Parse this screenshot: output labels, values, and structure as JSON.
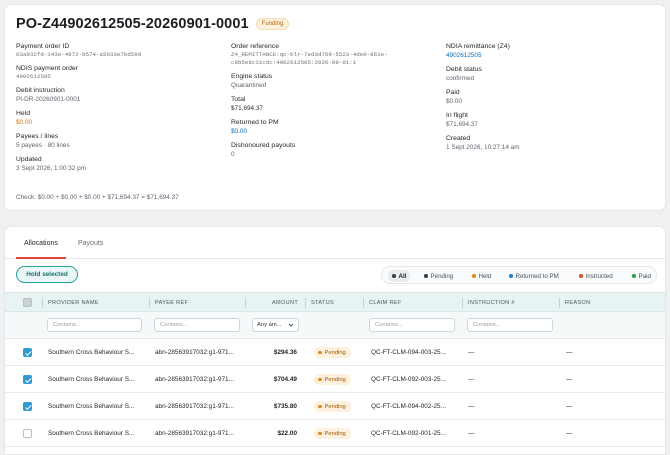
{
  "header": {
    "title": "PO-Z44902612505-20260901-0001",
    "badge": "Funding"
  },
  "details": {
    "col1": [
      {
        "label": "Payment order ID",
        "value": "03a932fd-143e-4972-b574-a5033e7bd59d",
        "style": "mono"
      },
      {
        "label": "NDIS payment order",
        "value": "4902612505",
        "style": "mono"
      },
      {
        "label": "Debit instruction",
        "value": "PI-DR-20260901-0001",
        "style": "plain"
      },
      {
        "label": "Held",
        "value": "$0.00",
        "style": "orange"
      },
      {
        "label": "Payees / lines",
        "value": "5 payees · 80 lines",
        "style": "plain"
      },
      {
        "label": "Updated",
        "value": "3 Sept 2026, 1:00:32 pm",
        "style": "plain"
      }
    ],
    "col2": [
      {
        "label": "Order reference",
        "value": "Z4_REMITTANCE:qc-blr-7ed3d769-5523-4de0-861e-c8b5e8c31cdc:4902612505:2026-09-01:1",
        "style": "mono"
      },
      {
        "label": "Engine status",
        "value": "Quarantined",
        "style": "plain"
      },
      {
        "label": "Total",
        "value": "$71,694.37",
        "style": "dark"
      },
      {
        "label": "Returned to PM",
        "value": "$0.00",
        "style": "blue"
      },
      {
        "label": "Dishonoured payouts",
        "value": "0",
        "style": "plain"
      }
    ],
    "col3": [
      {
        "label": "NDIA remittance (Z4)",
        "value": "4902612505",
        "style": "blue"
      },
      {
        "label": "Debit status",
        "value": "confirmed",
        "style": "plain"
      },
      {
        "label": "Paid",
        "value": "$0.00",
        "style": "plain"
      },
      {
        "label": "In flight",
        "value": "$71,694.37",
        "style": "plain"
      },
      {
        "label": "Created",
        "value": "1 Sept 2026, 10:27:14 am",
        "style": "plain"
      }
    ],
    "check": "Check: $0.00 + $0.00 + $0.00 + $71,694.37 = $71,694.37"
  },
  "tabs": [
    {
      "label": "Allocations",
      "active": true
    },
    {
      "label": "Payouts",
      "active": false
    }
  ],
  "toolbar": {
    "hold_label": "Hold selected"
  },
  "filters": [
    {
      "label": "All",
      "color": "#3b4148",
      "active": true
    },
    {
      "label": "Pending",
      "color": "#3b4148",
      "active": false
    },
    {
      "label": "Held",
      "color": "#e08a1e",
      "active": false
    },
    {
      "label": "Returned to PM",
      "color": "#1f86c9",
      "active": false
    },
    {
      "label": "Instructed",
      "color": "#d2562a",
      "active": false
    },
    {
      "label": "Paid",
      "color": "#2f9b4f",
      "active": false
    }
  ],
  "table": {
    "columns": [
      "PROVIDER NAME",
      "PAYEE REF",
      "AMOUNT",
      "STATUS",
      "CLAIM REF",
      "INSTRUCTION #",
      "REASON"
    ],
    "filter_placeholder": "Contains...",
    "amount_filter": "Any am...",
    "rows": [
      {
        "checked": true,
        "provider": "Southern Cross Behaviour S...",
        "payee": "abn-28563917032:g1-971...",
        "amount": "$294.36",
        "status": "Pending",
        "claim": "QC-FT-CLM-094-003-25...",
        "instruction": "—",
        "reason": "—"
      },
      {
        "checked": true,
        "provider": "Southern Cross Behaviour S...",
        "payee": "abn-28563917032:g1-971...",
        "amount": "$704.49",
        "status": "Pending",
        "claim": "QC-FT-CLM-092-003-25...",
        "instruction": "—",
        "reason": "—"
      },
      {
        "checked": true,
        "provider": "Southern Cross Behaviour S...",
        "payee": "abn-28563917032:g1-971...",
        "amount": "$735.80",
        "status": "Pending",
        "claim": "QC-FT-CLM-094-002-25...",
        "instruction": "—",
        "reason": "—"
      },
      {
        "checked": false,
        "provider": "Southern Cross Behaviour S...",
        "payee": "abn-28563917032:g1-971...",
        "amount": "$22.00",
        "status": "Pending",
        "claim": "QC-FT-CLM-092-001-25...",
        "instruction": "—",
        "reason": "—"
      }
    ]
  }
}
